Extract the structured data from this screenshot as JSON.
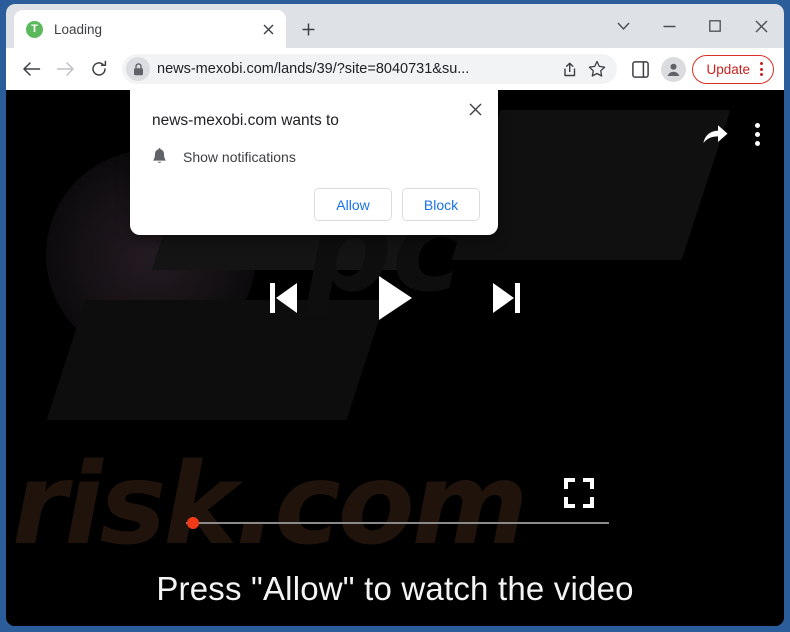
{
  "window": {
    "frame_color": "#2c5d9b",
    "controls": [
      {
        "name": "tab-search",
        "glyph": "⌄"
      },
      {
        "name": "minimize",
        "glyph": "—"
      },
      {
        "name": "maximize",
        "glyph": "▢"
      },
      {
        "name": "close",
        "glyph": "✕"
      }
    ]
  },
  "tabstrip": {
    "tab": {
      "favicon_letter": "T",
      "favicon_color": "#5cb85c",
      "title": "Loading",
      "close_glyph": "✕"
    },
    "new_tab_glyph": "+"
  },
  "toolbar": {
    "back_glyph": "←",
    "forward_glyph": "→",
    "reload_glyph": "⟳",
    "url": "news-mexobi.com/lands/39/?site=8040731&su...",
    "lock_glyph": "🔒",
    "share_glyph": "↱",
    "bookmark_glyph": "☆",
    "sidepanel_glyph": "▯",
    "profile_glyph": "●",
    "update_label": "Update",
    "update_color": "#c5221f"
  },
  "permission_dialog": {
    "title": "news-mexobi.com wants to",
    "permission_label": "Show notifications",
    "bell_icon": "bell-icon",
    "close_glyph": "✕",
    "allow_label": "Allow",
    "block_label": "Block",
    "button_text_color": "#1a73e8"
  },
  "video_player": {
    "share_icon": "share-arrow-icon",
    "menu_icon": "more-vertical-icon",
    "previous_icon": "skip-previous-icon",
    "play_icon": "play-icon",
    "next_icon": "skip-next-icon",
    "fullscreen_icon": "fullscreen-icon",
    "progress_percent": 0,
    "progress_thumb_color": "#f03a17",
    "headline": "Press \"Allow\" to watch the video",
    "watermark_text": "risk.com",
    "watermark_text_top": "pc"
  }
}
